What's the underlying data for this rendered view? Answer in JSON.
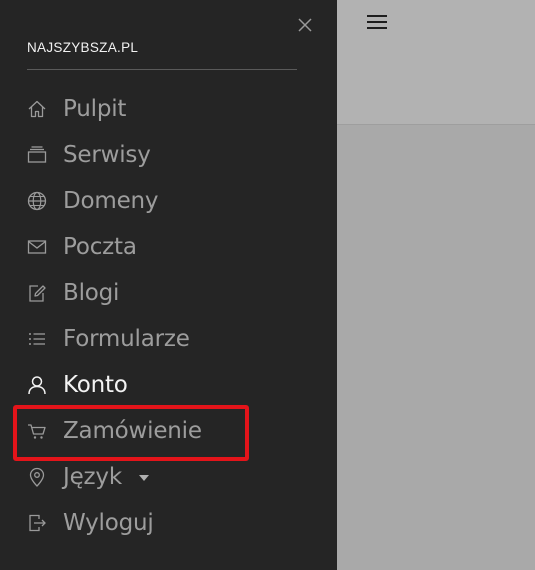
{
  "brand": {
    "name": "NAJSZYBSZA.PL"
  },
  "menu": {
    "items": [
      {
        "label": "Pulpit",
        "icon": "home-icon"
      },
      {
        "label": "Serwisy",
        "icon": "layers-icon"
      },
      {
        "label": "Domeny",
        "icon": "globe-icon"
      },
      {
        "label": "Poczta",
        "icon": "envelope-icon"
      },
      {
        "label": "Blogi",
        "icon": "edit-icon"
      },
      {
        "label": "Formularze",
        "icon": "list-icon"
      },
      {
        "label": "Konto",
        "icon": "user-icon",
        "active": true
      },
      {
        "label": "Zamówienie",
        "icon": "cart-icon",
        "highlighted": true
      },
      {
        "label": "Język",
        "icon": "location-pin-icon",
        "has_dropdown": true
      },
      {
        "label": "Wyloguj",
        "icon": "logout-icon"
      }
    ]
  },
  "colors": {
    "sidebar_bg": "#252525",
    "content_bg": "#a9a9a9",
    "header_bg": "#b2b2b2",
    "menu_text": "#9d9d9d",
    "active_text": "#f3f3f3",
    "highlight_border": "#e4141a"
  }
}
